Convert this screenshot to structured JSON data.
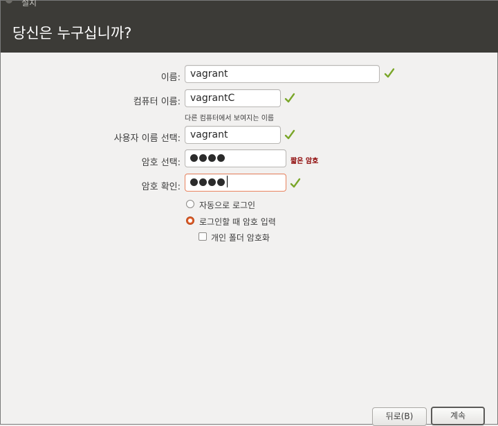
{
  "window": {
    "titlebar_text": "설치"
  },
  "header": {
    "title": "당신은 누구십니까?"
  },
  "form": {
    "name": {
      "label": "이름:",
      "value": "vagrant"
    },
    "computer_name": {
      "label": "컴퓨터 이름:",
      "value": "vagrantC",
      "hint": "다른 컴퓨터에서 보여지는 이름"
    },
    "username": {
      "label": "사용자 이름 선택:",
      "value": "vagrant"
    },
    "password": {
      "label": "암호 선택:",
      "strength": "짧은 암호"
    },
    "password_confirm": {
      "label": "암호 확인:"
    }
  },
  "options": {
    "auto_login": {
      "label": "자동으로 로그인",
      "selected": false
    },
    "require_password": {
      "label": "로그인할 때 암호 입력",
      "selected": true
    },
    "encrypt_home": {
      "label": "개인 폴더 암호화",
      "checked": false
    }
  },
  "buttons": {
    "back": "뒤로(B)",
    "continue": "계속"
  },
  "colors": {
    "header_bg": "#3c3b37",
    "accent": "#e05a25",
    "check": "#7aa629",
    "warning": "#8b0000"
  }
}
